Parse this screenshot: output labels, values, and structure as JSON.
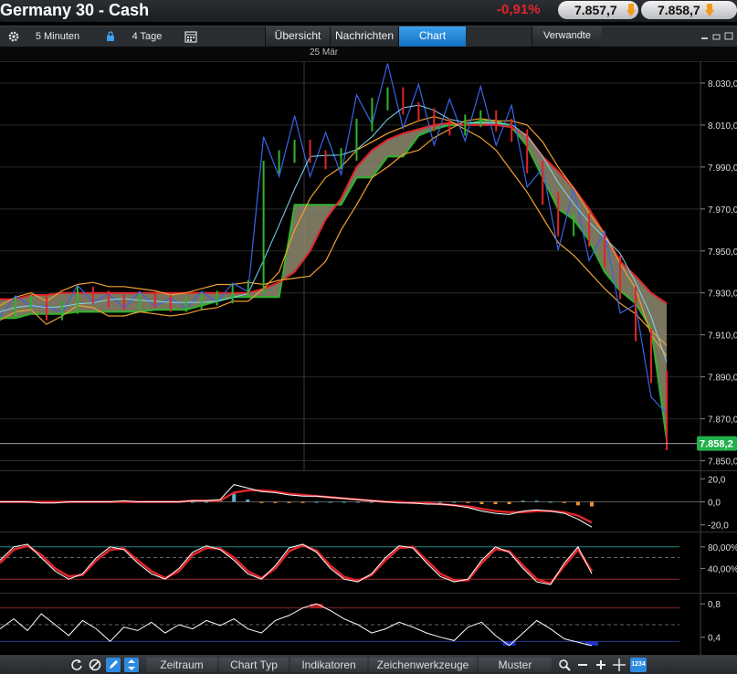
{
  "header": {
    "title": "Germany 30 - Cash",
    "change": "-0,91%",
    "bid": "7.857,7",
    "ask": "7.858,7"
  },
  "toolbar": {
    "interval": "5 Minuten",
    "range": "4 Tage",
    "tabs": [
      "Übersicht",
      "Nachrichten",
      "Chart"
    ],
    "active_tab": "Chart",
    "related": "Verwandte"
  },
  "date_label": "25 Mär",
  "bottom_toolbar": {
    "buttons": [
      "Zeitraum",
      "Chart Typ",
      "Indikatoren",
      "Zeichenwerkzeuge",
      "Muster"
    ],
    "icon_label": "1234"
  },
  "colors": {
    "price_up": "#2db52d",
    "price_down": "#e0252a",
    "cloud_fill": "#8e8a6e",
    "bollinger": "#f0a030",
    "channel_blue": "#3a63e8",
    "average": "#7fd6f0",
    "accent_tab": "#2288dd",
    "current_price_badge": "#22b14c"
  },
  "chart_data": [
    {
      "type": "line",
      "panel": "price",
      "ylim": [
        7845,
        8040
      ],
      "y_ticks": [
        "8.030,0",
        "8.010,0",
        "7.990,0",
        "7.970,0",
        "7.950,0",
        "7.930,0",
        "7.910,0",
        "7.890,0",
        "7.870,0",
        "7.850,0"
      ],
      "current_price": "7.858,2",
      "series": [
        {
          "values": [
            7921,
            7925,
            7926,
            7920,
            7923,
            7930,
            7928,
            7926,
            7925,
            7927,
            7926,
            7924,
            7925,
            7927,
            7928,
            7931,
            7933,
            7990,
            7995,
            8000,
            7995,
            7992,
            7996,
            8010,
            8020,
            8025,
            8018,
            8015,
            8010,
            8008,
            8012,
            8014,
            8010,
            8005,
            7990,
            7975,
            7960,
            7965,
            7955,
            7945,
            7930,
            7910,
            7890,
            7858
          ]
        },
        {
          "values": [
            7924,
            7928,
            7930,
            7926,
            7931,
            7934,
            7935,
            7933,
            7933,
            7932,
            7931,
            7929,
            7930,
            7932,
            7934,
            7934,
            7935,
            7934,
            7936,
            7937,
            7938,
            7945,
            7960,
            7972,
            7985,
            7990,
            7996,
            7998,
            8004,
            8008,
            8012,
            8013,
            8012,
            8012,
            8010,
            8002,
            7990,
            7980,
            7968,
            7958,
            7944,
            7932,
            7910,
            7900
          ]
        },
        {
          "values": [
            7917,
            7921,
            7922,
            7915,
            7919,
            7924,
            7923,
            7919,
            7919,
            7921,
            7920,
            7919,
            7920,
            7922,
            7923,
            7926,
            7926,
            7932,
            7940,
            7960,
            7975,
            7985,
            7990,
            7998,
            8002,
            8006,
            8009,
            8012,
            8014,
            8012,
            8008,
            8004,
            7998,
            7988,
            7978,
            7966,
            7954,
            7948,
            7940,
            7932,
            7925,
            7920,
            7912,
            7905
          ]
        },
        {
          "values": [
            7918,
            7918,
            7920,
            7920,
            7920,
            7921,
            7921,
            7921,
            7921,
            7921,
            7922,
            7922,
            7922,
            7924,
            7926,
            7928,
            7928,
            7928,
            7928,
            7972,
            7972,
            7972,
            7972,
            7985,
            7985,
            7995,
            7995,
            8005,
            8008,
            8010,
            8010,
            8012,
            8012,
            8009,
            8000,
            7985,
            7970,
            7965,
            7955,
            7940,
            7931,
            7925,
            7913,
            7860
          ]
        },
        {
          "values": [
            7927,
            7927,
            7929,
            7929,
            7930,
            7930,
            7930,
            7930,
            7930,
            7930,
            7930,
            7930,
            7930,
            7930,
            7930,
            7930,
            7930,
            7932,
            7935,
            7940,
            7950,
            7965,
            7975,
            7990,
            7998,
            8003,
            8006,
            8008,
            8010,
            8011,
            8010,
            8010,
            8010,
            8009,
            8005,
            7995,
            7988,
            7980,
            7970,
            7958,
            7945,
            7938,
            7930,
            7925
          ]
        }
      ]
    },
    {
      "type": "area",
      "panel": "macd",
      "ylim": [
        -25,
        25
      ],
      "y_ticks": [
        "20,0",
        "0,0",
        "-20,0"
      ],
      "series": [
        {
          "values": [
            0,
            0,
            0,
            -1,
            -1,
            0,
            0,
            0,
            0,
            1,
            0,
            0,
            0,
            0,
            1,
            1,
            2,
            15,
            12,
            9,
            8,
            6,
            5,
            5,
            4,
            3,
            2,
            1,
            0,
            -1,
            -1,
            -2,
            -2,
            -3,
            -5,
            -8,
            -10,
            -11,
            -8,
            -7,
            -8,
            -10,
            -15,
            -22
          ]
        },
        {
          "values": [
            0,
            0,
            0,
            0,
            0,
            0,
            0,
            0,
            0,
            0,
            0,
            0,
            0,
            0,
            1,
            1,
            1,
            8,
            10,
            10,
            9,
            7,
            6,
            5,
            4,
            3,
            2,
            1,
            0,
            0,
            -1,
            -1,
            -2,
            -3,
            -4,
            -6,
            -8,
            -9,
            -9,
            -8,
            -8,
            -9,
            -12,
            -18
          ]
        },
        {
          "values": [
            0,
            0,
            0,
            -1,
            -1,
            0,
            0,
            0,
            0,
            1,
            0,
            0,
            0,
            0,
            0,
            0,
            1,
            7,
            2,
            -1,
            -1,
            -1,
            -1,
            0,
            0,
            0,
            0,
            0,
            0,
            -1,
            0,
            -1,
            0,
            0,
            -1,
            -2,
            -2,
            -2,
            1,
            1,
            0,
            -1,
            -3,
            -4
          ]
        }
      ]
    },
    {
      "type": "line",
      "panel": "stochastic",
      "ylim": [
        0,
        100
      ],
      "y_ticks": [
        "80,00%",
        "40,00%"
      ],
      "series": [
        {
          "values": [
            55,
            80,
            85,
            60,
            35,
            20,
            30,
            60,
            80,
            75,
            50,
            30,
            20,
            40,
            70,
            82,
            75,
            55,
            30,
            20,
            45,
            78,
            85,
            70,
            40,
            20,
            15,
            30,
            60,
            82,
            78,
            50,
            25,
            15,
            20,
            55,
            80,
            70,
            40,
            15,
            10,
            50,
            80,
            30
          ]
        },
        {
          "values": [
            50,
            75,
            82,
            65,
            40,
            25,
            28,
            55,
            75,
            77,
            55,
            35,
            22,
            35,
            65,
            78,
            77,
            60,
            35,
            22,
            40,
            72,
            83,
            73,
            45,
            24,
            17,
            28,
            55,
            78,
            80,
            55,
            30,
            18,
            18,
            50,
            76,
            72,
            45,
            20,
            12,
            45,
            75,
            35
          ]
        }
      ]
    },
    {
      "type": "line",
      "panel": "oscillator",
      "ylim": [
        0.2,
        0.9
      ],
      "y_ticks": [
        "0,8",
        "0,4"
      ],
      "series": [
        {
          "values": [
            0.5,
            0.62,
            0.48,
            0.68,
            0.55,
            0.42,
            0.6,
            0.5,
            0.35,
            0.52,
            0.48,
            0.58,
            0.45,
            0.55,
            0.5,
            0.6,
            0.54,
            0.62,
            0.5,
            0.45,
            0.6,
            0.66,
            0.75,
            0.8,
            0.72,
            0.62,
            0.55,
            0.45,
            0.5,
            0.58,
            0.52,
            0.45,
            0.4,
            0.36,
            0.52,
            0.58,
            0.42,
            0.3,
            0.45,
            0.6,
            0.5,
            0.38,
            0.34,
            0.3
          ]
        }
      ]
    }
  ]
}
